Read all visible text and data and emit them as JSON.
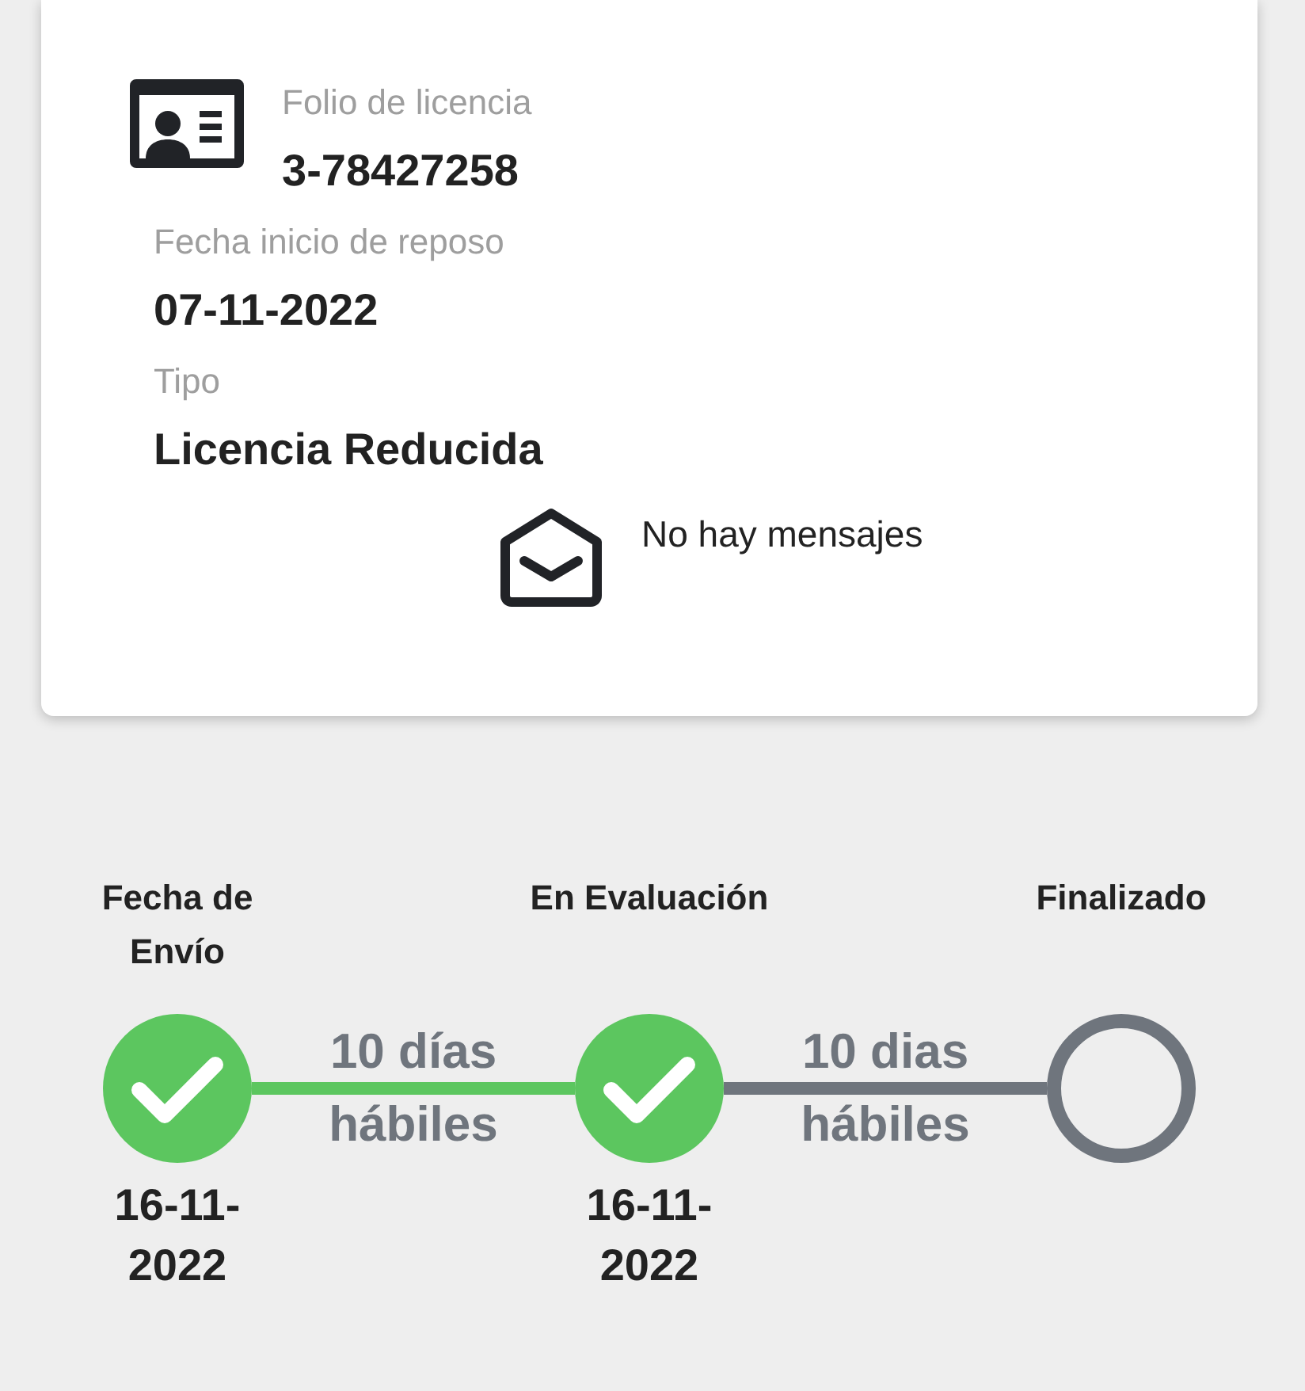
{
  "license_card": {
    "folio": {
      "label": "Folio de licencia",
      "value": "3-78427258"
    },
    "fields": [
      {
        "label": "Fecha inicio de reposo",
        "value": "07-11-2022"
      },
      {
        "label": "Tipo",
        "value": "Licencia Reducida"
      }
    ],
    "messages": "No hay mensajes"
  },
  "timeline": {
    "steps": [
      {
        "title": "Fecha de Envío",
        "done": true,
        "date": "16-11-2022"
      },
      {
        "title": "En Evaluación",
        "done": true,
        "date": "16-11-2022"
      },
      {
        "title": "Finalizado",
        "done": false
      }
    ],
    "connectors": [
      {
        "label": "10 días hábiles",
        "done": true
      },
      {
        "label": "10 dias hábiles",
        "done": false
      }
    ]
  }
}
